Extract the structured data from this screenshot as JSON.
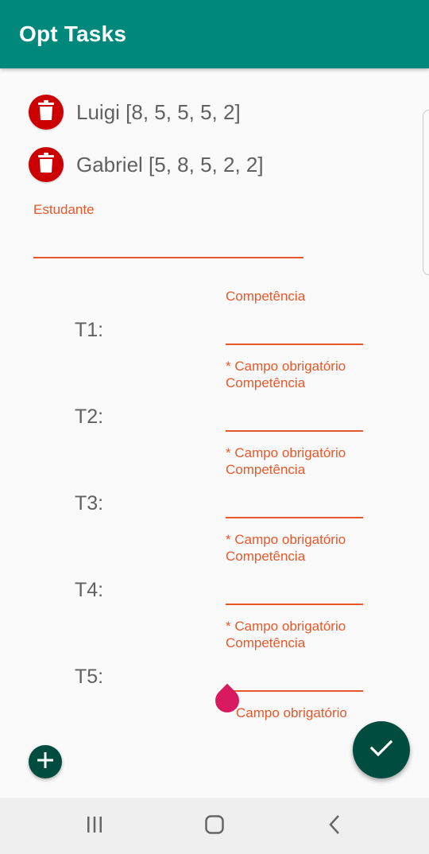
{
  "app_bar": {
    "title": "Opt Tasks",
    "color": "#00897b"
  },
  "students": [
    {
      "label": "Luigi [8, 5, 5, 5, 2]",
      "icon": "trash-icon"
    },
    {
      "label": "Gabriel [5, 8, 5, 2, 2]",
      "icon": "trash-icon"
    }
  ],
  "student_field": {
    "label": "Estudante",
    "value": ""
  },
  "tasks": [
    {
      "label": "T1:",
      "field_label": "Competência",
      "helper": "* Campo obrigatório"
    },
    {
      "label": "T2:",
      "field_label": "Competência",
      "helper": "* Campo obrigatório"
    },
    {
      "label": "T3:",
      "field_label": "Competência",
      "helper": "* Campo obrigatório"
    },
    {
      "label": "T4:",
      "field_label": "Competência",
      "helper": "* Campo obrigatório"
    },
    {
      "label": "T5:",
      "field_label": "Competência",
      "helper": "Campo obrigatório"
    }
  ],
  "buttons": {
    "add": "add-icon",
    "confirm": "check-icon"
  },
  "nav": {
    "recents": "recents-icon",
    "home": "home-icon",
    "back": "back-icon"
  },
  "colors": {
    "accent": "#e8582b",
    "fab": "#004d40",
    "delete": "#cc0000",
    "cursor": "#d81b60"
  }
}
